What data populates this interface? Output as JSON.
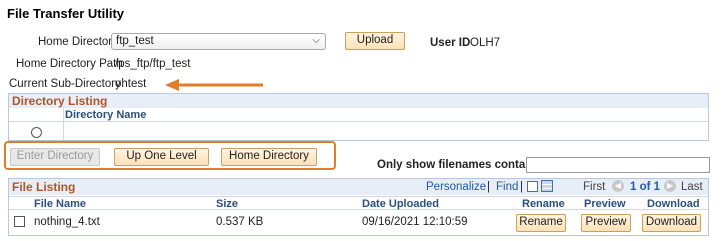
{
  "page": {
    "title": "File Transfer Utility"
  },
  "form": {
    "home_dir_label": "Home Directory",
    "home_dir_value": "ftp_test",
    "upload_label": "Upload",
    "user_id_label": "User ID",
    "user_id_value": "OLH7",
    "home_dir_path_label": "Home Directory Path",
    "home_dir_path_value": "/ps_ftp/ftp_test",
    "current_subdir_label": "Current Sub-Directory",
    "current_subdir_value": "ohtest"
  },
  "directory_listing": {
    "title": "Directory Listing",
    "column": "Directory Name"
  },
  "nav_buttons": {
    "enter_directory": "Enter Directory",
    "up_one_level": "Up One Level",
    "home_directory": "Home Directory"
  },
  "filter": {
    "label": "Only show filenames containing",
    "value": ""
  },
  "file_listing": {
    "title": "File Listing",
    "personalize": "Personalize",
    "separator1": "|",
    "find": "Find",
    "separator2": "|",
    "first": "First",
    "page_info": "1 of 1",
    "last": "Last",
    "columns": {
      "file_name": "File Name",
      "size": "Size",
      "date_uploaded": "Date Uploaded",
      "rename": "Rename",
      "preview": "Preview",
      "download": "Download"
    },
    "rows": [
      {
        "file_name": "nothing_4.txt",
        "size": "0.537 KB",
        "date_uploaded": "09/16/2021 12:10:59",
        "rename": "Rename",
        "preview": "Preview",
        "download": "Download"
      }
    ]
  },
  "colors": {
    "accent": "#e07d2a",
    "section_title": "#b0552b",
    "link": "#1e5ba8"
  },
  "icons": [
    "chevron-down-icon",
    "arrow-left-icon",
    "radio-icon",
    "view-all-icon",
    "grid-icon",
    "prev-icon",
    "next-icon",
    "checkbox-icon"
  ]
}
